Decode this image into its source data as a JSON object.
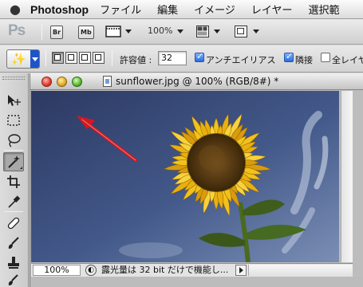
{
  "menubar": {
    "app_name": "Photoshop",
    "items": [
      "ファイル",
      "編集",
      "イメージ",
      "レイヤー",
      "選択範"
    ]
  },
  "appbar": {
    "logo": "Ps",
    "bridge_badge": "Br",
    "minibridge_badge": "Mb",
    "zoom_label": "100%"
  },
  "options": {
    "tolerance_label": "許容値 :",
    "tolerance_value": "32",
    "antialias_label": "アンチエイリアス",
    "antialias_checked": true,
    "contiguous_label": "隣接",
    "contiguous_checked": true,
    "all_layers_label": "全レイヤ",
    "all_layers_checked": false
  },
  "tools": [
    {
      "name": "move-tool",
      "glyph": "▸✥"
    },
    {
      "name": "marquee-tool",
      "glyph": "⬚"
    },
    {
      "name": "lasso-tool",
      "glyph": "ᘐ"
    },
    {
      "name": "magic-wand-tool",
      "glyph": "✧",
      "active": true
    },
    {
      "name": "crop-tool",
      "glyph": "⌗"
    },
    {
      "name": "eyedropper-tool",
      "glyph": "✎"
    },
    {
      "name": "healing-brush-tool",
      "glyph": "✚"
    },
    {
      "name": "brush-tool",
      "glyph": "🖌"
    },
    {
      "name": "clone-stamp-tool",
      "glyph": "♜"
    },
    {
      "name": "history-brush-tool",
      "glyph": "↺"
    }
  ],
  "document": {
    "title": "sunflower.jpg @ 100% (RGB/8#) *",
    "zoom": "100%",
    "status_text": "露光量は 32 bit だけで機能し..."
  },
  "colors": {
    "sky_top": "#2f3c66",
    "sky_bottom": "#7185ad",
    "petal": "#f2c21c",
    "center": "#5b3c12",
    "arrow": "#d8161f"
  }
}
